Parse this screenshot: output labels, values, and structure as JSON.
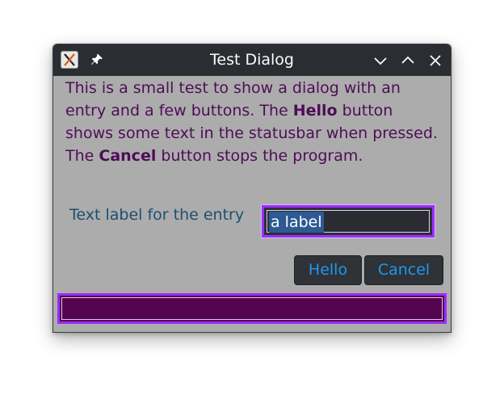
{
  "window": {
    "title": "Test Dialog",
    "icons": [
      "app-icon",
      "pin-icon",
      "minimize-icon",
      "maximize-icon",
      "close-icon"
    ]
  },
  "body": {
    "part1": "This is a small test to show a dialog with an entry and a few buttons. The ",
    "bold1": "Hello",
    "part2": " button shows some text in the statusbar when pressed. The ",
    "bold2": "Cancel",
    "part3": " button stops the program."
  },
  "entry": {
    "label": "Text label for the entry",
    "value": "a label"
  },
  "buttons": {
    "hello": "Hello",
    "cancel": "Cancel"
  },
  "statusbar": {
    "text": ""
  },
  "colors": {
    "titlebar": "#2a2e32",
    "window_bg": "#acacac",
    "body_text": "#4e0d57",
    "label_text": "#1d4f6e",
    "button_text": "#1d99f3",
    "focus_border": "#9a2dff",
    "statusbar_bg": "#55054f",
    "selection": "#2d5a92"
  }
}
